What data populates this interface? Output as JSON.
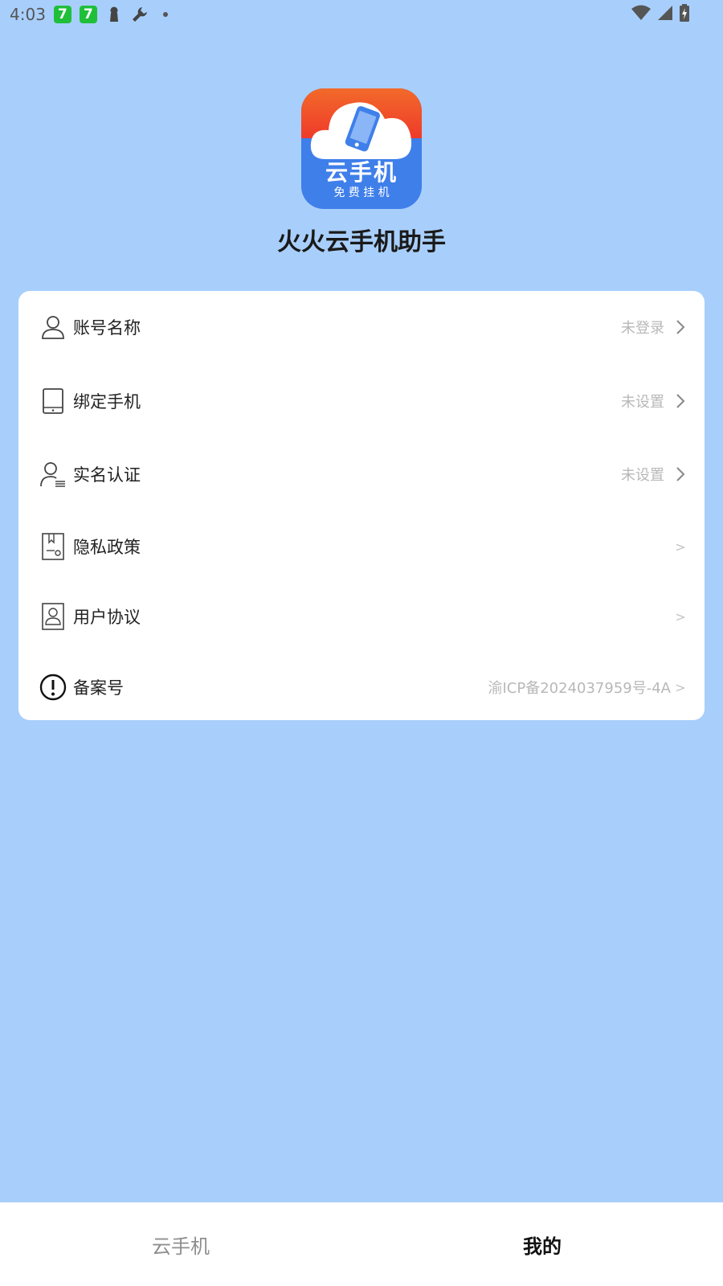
{
  "status_bar": {
    "time": "4:03",
    "badge1": "7",
    "badge2": "7",
    "icons": [
      "keyhole-icon",
      "wrench-icon",
      "dot-icon",
      "wifi-icon",
      "signal-icon",
      "battery-icon"
    ]
  },
  "app": {
    "logo_title": "云手机",
    "logo_subtitle": "免 费 挂 机",
    "name": "火火云手机助手"
  },
  "menu": {
    "items": [
      {
        "label": "账号名称",
        "value": "未登录",
        "icon": "user-icon"
      },
      {
        "label": "绑定手机",
        "value": "未设置",
        "icon": "phone-icon"
      },
      {
        "label": "实名认证",
        "value": "未设置",
        "icon": "id-verify-icon"
      },
      {
        "label": "隐私政策",
        "value": "",
        "icon": "document-icon",
        "chevron": ">"
      },
      {
        "label": "用户协议",
        "value": "",
        "icon": "agreement-icon",
        "chevron": ">"
      },
      {
        "label": "备案号",
        "value": "渝ICP备2024037959号-4A",
        "icon": "exclamation-icon",
        "chevron": ">"
      }
    ]
  },
  "bottom_nav": {
    "tabs": [
      {
        "label": "云手机",
        "active": false
      },
      {
        "label": "我的",
        "active": true
      }
    ]
  },
  "colors": {
    "background": "#a8cffb",
    "card": "#ffffff",
    "logo_blue": "#3f7fea",
    "logo_red": "#f04a2d",
    "muted_text": "#b8b8b8"
  }
}
